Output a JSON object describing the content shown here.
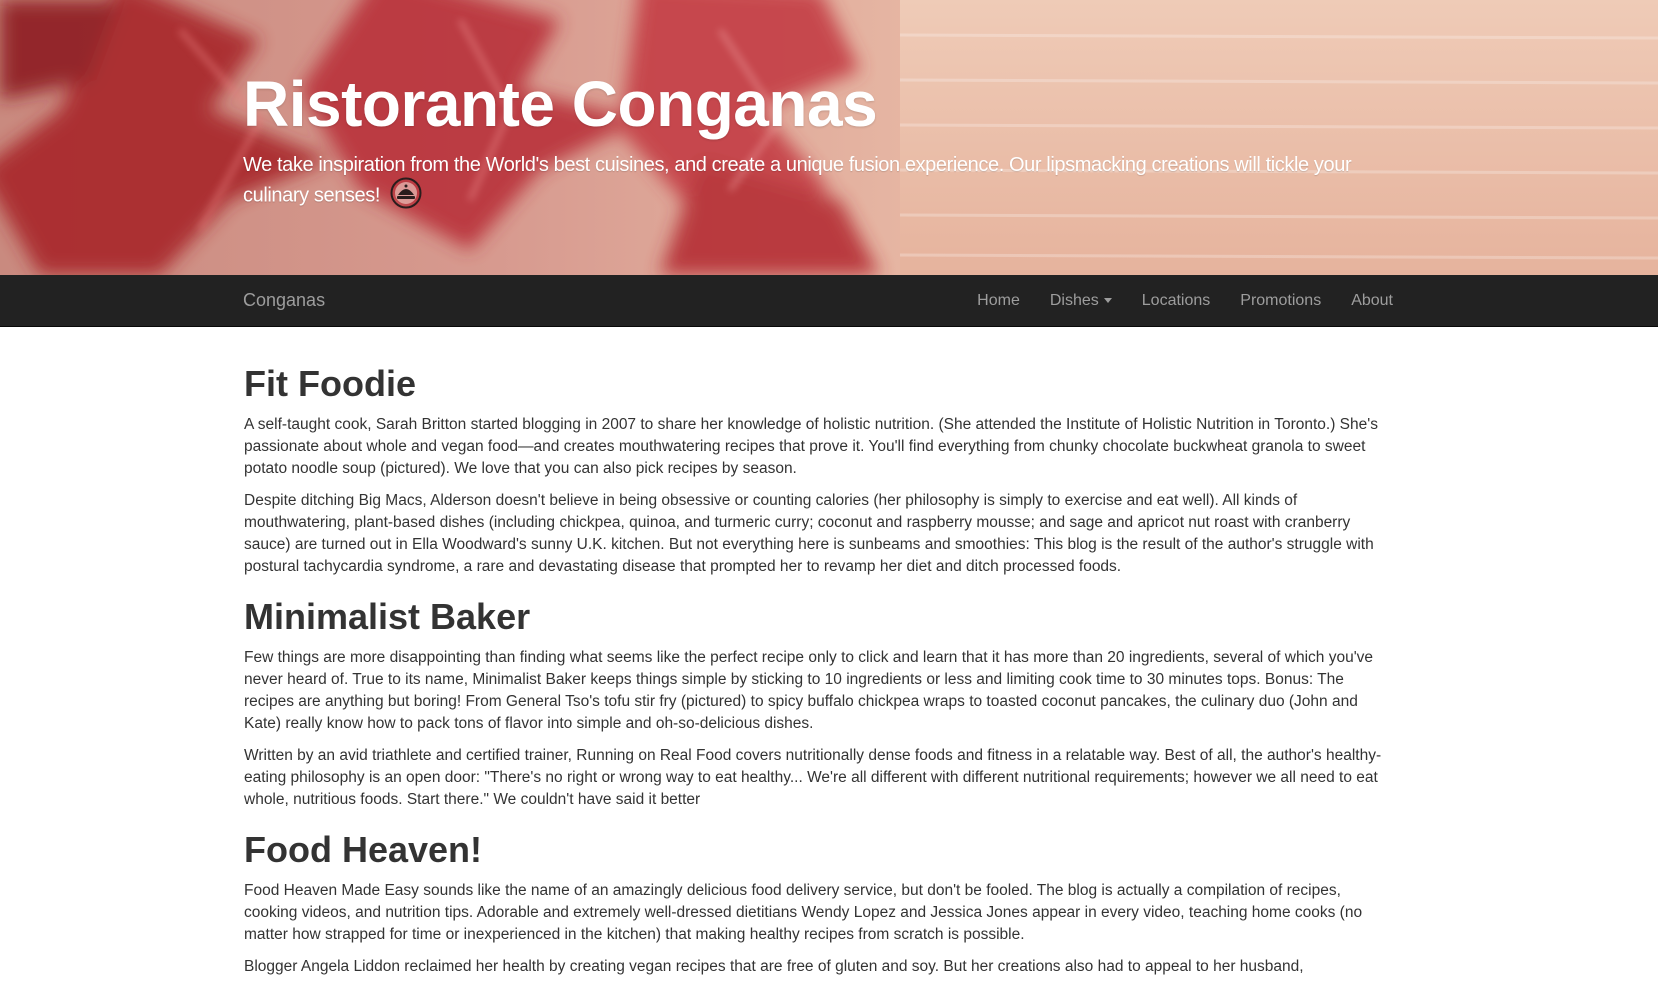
{
  "hero": {
    "title": "Ristorante Conganas",
    "tagline": "We take inspiration from the World's best cuisines, and create a unique fusion experience. Our lipsmacking creations will tickle your culinary senses!",
    "logo_icon": "restaurant-logo-icon"
  },
  "navbar": {
    "brand": "Conganas",
    "items": [
      {
        "label": "Home"
      },
      {
        "label": "Dishes",
        "dropdown": true
      },
      {
        "label": "Locations"
      },
      {
        "label": "Promotions"
      },
      {
        "label": "About"
      }
    ]
  },
  "sections": [
    {
      "heading": "Fit Foodie",
      "paragraphs": [
        "A self-taught cook, Sarah Britton started blogging in 2007 to share her knowledge of holistic nutrition. (She attended the Institute of Holistic Nutrition in Toronto.) She's passionate about whole and vegan food—and creates mouthwatering recipes that prove it. You'll find everything from chunky chocolate buckwheat granola to sweet potato noodle soup (pictured). We love that you can also pick recipes by season.",
        "Despite ditching Big Macs, Alderson doesn't believe in being obsessive or counting calories (her philosophy is simply to exercise and eat well). All kinds of mouthwatering, plant-based dishes (including chickpea, quinoa, and turmeric curry; coconut and raspberry mousse; and sage and apricot nut roast with cranberry sauce) are turned out in Ella Woodward's sunny U.K. kitchen. But not everything here is sunbeams and smoothies: This blog is the result of the author's struggle with postural tachycardia syndrome, a rare and devastating disease that prompted her to revamp her diet and ditch processed foods."
      ]
    },
    {
      "heading": "Minimalist Baker",
      "paragraphs": [
        "Few things are more disappointing than finding what seems like the perfect recipe only to click and learn that it has more than 20 ingredients, several of which you've never heard of. True to its name, Minimalist Baker keeps things simple by sticking to 10 ingredients or less and limiting cook time to 30 minutes tops. Bonus: The recipes are anything but boring! From General Tso's tofu stir fry (pictured) to spicy buffalo chickpea wraps to toasted coconut pancakes, the culinary duo (John and Kate) really know how to pack tons of flavor into simple and oh-so-delicious dishes.",
        "Written by an avid triathlete and certified trainer, Running on Real Food covers nutritionally dense foods and fitness in a relatable way. Best of all, the author's healthy-eating philosophy is an open door: \"There's no right or wrong way to eat healthy... We're all different with different nutritional requirements; however we all need to eat whole, nutritious foods. Start there.\" We couldn't have said it better"
      ]
    },
    {
      "heading": "Food Heaven!",
      "paragraphs": [
        "Food Heaven Made Easy sounds like the name of an amazingly delicious food delivery service, but don't be fooled. The blog is actually a compilation of recipes, cooking videos, and nutrition tips. Adorable and extremely well-dressed dietitians Wendy Lopez and Jessica Jones appear in every video, teaching home cooks (no matter how strapped for time or inexperienced in the kitchen) that making healthy recipes from scratch is possible.",
        "Blogger Angela Liddon reclaimed her health by creating vegan recipes that are free of gluten and soy. But her creations also had to appeal to her husband,"
      ]
    }
  ]
}
